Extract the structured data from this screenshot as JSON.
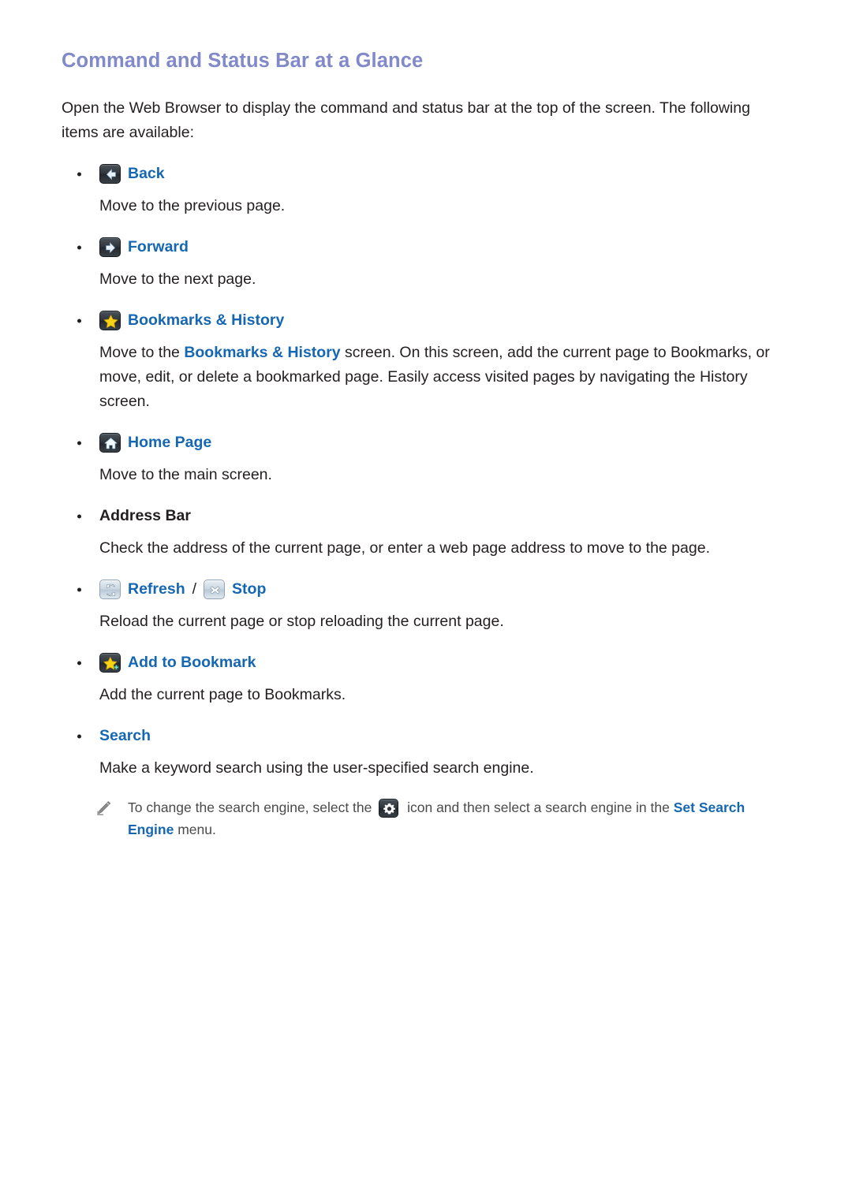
{
  "document": {
    "title": "Command and Status Bar at a Glance",
    "intro": "Open the Web Browser to display the command and status bar at the top of the screen. The following items are available:"
  },
  "items": [
    {
      "id": "back",
      "icon": "back-arrow-icon",
      "label": "Back",
      "label_color": "#1667b2",
      "description": "Move to the previous page."
    },
    {
      "id": "forward",
      "icon": "forward-arrow-icon",
      "label": "Forward",
      "label_color": "#1667b2",
      "description": "Move to the next page."
    },
    {
      "id": "bookmarks-history",
      "icon": "star-icon",
      "label": "Bookmarks & History",
      "label_color": "#1667b2",
      "description_part1": "Move to the ",
      "description_link": "Bookmarks & History",
      "description_part2": " screen. On this screen, add the current page to Bookmarks, or move, edit, or delete a bookmarked page. Easily access visited pages by navigating the History screen."
    },
    {
      "id": "home-page",
      "icon": "home-icon",
      "label": "Home Page",
      "label_color": "#1667b2",
      "description": "Move to the main screen."
    },
    {
      "id": "address-bar",
      "icon": null,
      "label": "Address Bar",
      "label_color": "#231f20",
      "description": "Check the address of the current page, or enter a web page address to move to the page."
    },
    {
      "id": "refresh-stop",
      "icon": "refresh-icon",
      "label": "Refresh",
      "separator": "/",
      "icon2": "stop-x-icon",
      "label2": "Stop",
      "label_color": "#1667b2",
      "description": "Reload the current page or stop reloading the current page."
    },
    {
      "id": "add-to-bookmark",
      "icon": "star-plus-icon",
      "label": "Add to Bookmark",
      "label_color": "#1667b2",
      "description": "Add the current page to Bookmarks."
    },
    {
      "id": "search",
      "icon": null,
      "label": "Search",
      "label_color": "#1667b2",
      "description": "Make a keyword search using the user-specified search engine."
    }
  ],
  "note": {
    "icon": "pencil-icon",
    "text_part1": "To change the search engine, select the ",
    "inline_icon": "gear-icon",
    "text_part2": " icon and then select a search engine in the ",
    "link": "Set Search Engine",
    "text_part3": " menu."
  },
  "colors": {
    "heading": "#8189c9",
    "link": "#1667b2",
    "body": "#231f20",
    "note_text": "#4a4a4a",
    "icon_dark": "#2f353b",
    "icon_light": "#c9d6e2",
    "star": "#f5cf23"
  }
}
